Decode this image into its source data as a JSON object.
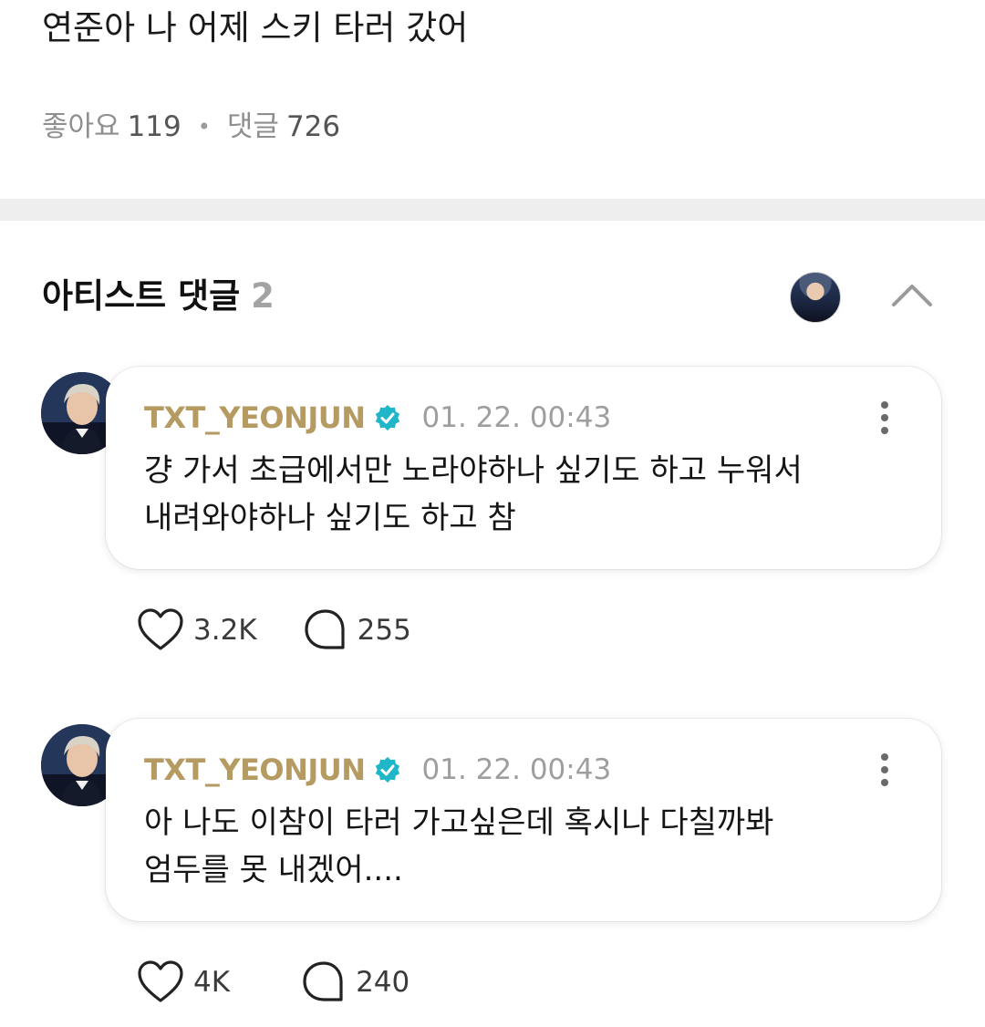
{
  "post": {
    "text": "연준아 나 어제 스키 타러 갔어",
    "likes_label": "좋아요",
    "likes_count": "119",
    "comments_label": "댓글",
    "comments_count": "726"
  },
  "artist_comments": {
    "title": "아티스트 댓글",
    "count": "2"
  },
  "comments": [
    {
      "username": "TXT_YEONJUN",
      "time": "01. 22. 00:43",
      "line1": "걍 가서 초급에서만 노라야하나 싶기도 하고 누워서",
      "line2": "내려와야하나 싶기도 하고 참",
      "likes": "3.2K",
      "replies": "255"
    },
    {
      "username": "TXT_YEONJUN",
      "time": "01. 22. 00:43",
      "line1": "아 나도 이참이 타러 가고싶은데 혹시나 다칠까봐",
      "line2": "엄두를 못 내겠어....",
      "likes": "4K",
      "replies": "240"
    }
  ],
  "icons": {
    "verified": "verified-badge-icon",
    "more": "more-vertical-icon",
    "heart": "heart-icon",
    "comment": "comment-bubble-icon",
    "collapse": "chevron-up-icon"
  },
  "colors": {
    "username": "#b59a62",
    "verified": "#1fb6c9",
    "muted": "#9e9e9e"
  }
}
